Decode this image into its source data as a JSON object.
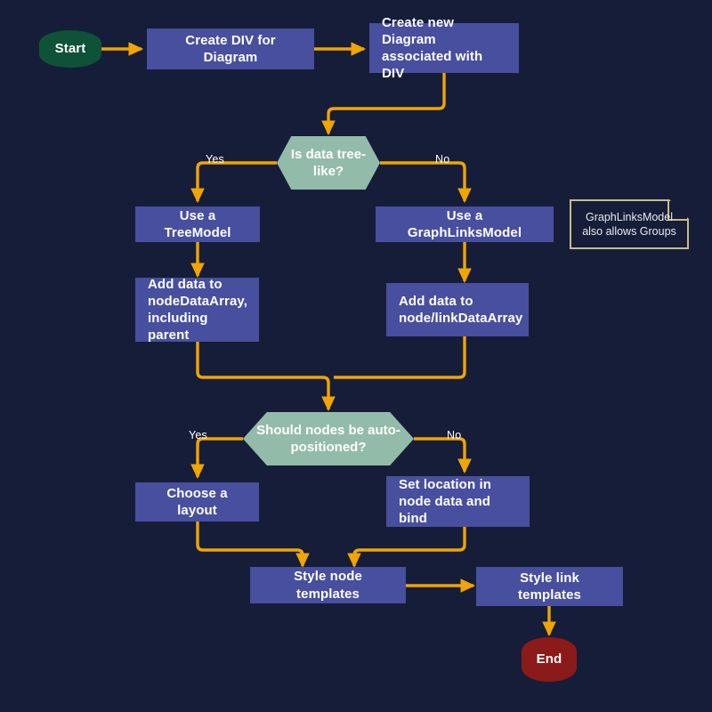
{
  "diagram": {
    "title": "GoJS diagram setup flowchart",
    "background_color": "#161d38",
    "link_color": "#f0a500",
    "colors": {
      "process": "#474f9e",
      "decision": "#93bba9",
      "start": "#0e5237",
      "end": "#8b1a1a",
      "note_border": "#c9bd83",
      "text": "#ffffff"
    }
  },
  "nodes": {
    "start": "Start",
    "create_div": "Create DIV for Diagram",
    "create_diagram": "Create new Diagram associated with DIV",
    "decision_tree": "Is data tree-like?",
    "use_treemodel": "Use a TreeModel",
    "use_graphlinksmodel": "Use a GraphLinksModel",
    "add_data_tree": "Add data to nodeDataArray, including parent",
    "add_data_graph": "Add data to node/linkDataArray",
    "decision_autopos": "Should nodes be auto-positioned?",
    "choose_layout": "Choose a layout",
    "set_location": "Set location in node data and bind",
    "style_node": "Style node templates",
    "style_link": "Style link templates",
    "end": "End"
  },
  "note": {
    "text": "GraphLinksModel also allows Groups"
  },
  "edge_labels": {
    "tree_yes": "Yes",
    "tree_no": "No",
    "autopos_yes": "Yes",
    "autopos_no": "No"
  }
}
